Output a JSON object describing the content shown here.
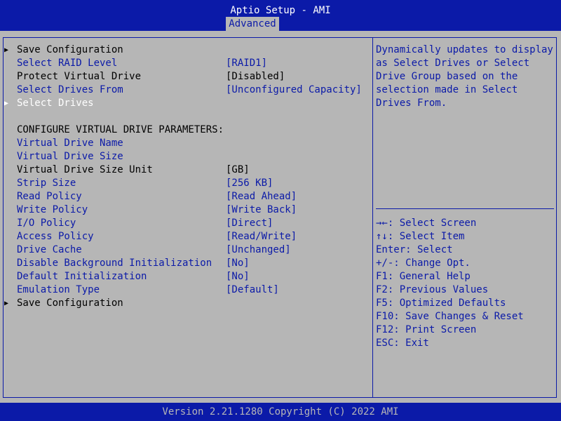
{
  "header": {
    "title": "Aptio Setup - AMI",
    "active_tab": "Advanced"
  },
  "footer": {
    "version": "Version 2.21.1280 Copyright (C) 2022 AMI"
  },
  "menu": {
    "save_config_top": "Save Configuration",
    "raid_level_label": "Select RAID Level",
    "raid_level_value": "[RAID1]",
    "protect_label": "Protect Virtual Drive",
    "protect_value": "[Disabled]",
    "drives_from_label": "Select Drives From",
    "drives_from_value": "[Unconfigured Capacity]",
    "select_drives": "Select Drives",
    "section_heading": "CONFIGURE VIRTUAL DRIVE PARAMETERS:",
    "vd_name_label": "Virtual Drive Name",
    "vd_size_label": "Virtual Drive Size",
    "vd_size_unit_label": "Virtual Drive Size Unit",
    "vd_size_unit_value": "[GB]",
    "strip_size_label": "Strip Size",
    "strip_size_value": "[256 KB]",
    "read_policy_label": "Read Policy",
    "read_policy_value": "[Read Ahead]",
    "write_policy_label": "Write Policy",
    "write_policy_value": "[Write Back]",
    "io_policy_label": "I/O Policy",
    "io_policy_value": "[Direct]",
    "access_policy_label": "Access Policy",
    "access_policy_value": "[Read/Write]",
    "drive_cache_label": "Drive Cache",
    "drive_cache_value": "[Unchanged]",
    "disable_bgi_label": "Disable Background Initialization",
    "disable_bgi_value": "[No]",
    "default_init_label": "Default Initialization",
    "default_init_value": "[No]",
    "emulation_label": "Emulation Type",
    "emulation_value": "[Default]",
    "save_config_bottom": "Save Configuration"
  },
  "help": {
    "lines": [
      "Dynamically updates to display",
      "as Select Drives or Select",
      "Drive Group based on the",
      "selection made in Select",
      "Drives From."
    ]
  },
  "keys": {
    "lines": [
      "→←: Select Screen",
      "↑↓: Select Item",
      "Enter: Select",
      "+/-: Change Opt.",
      "F1: General Help",
      "F2: Previous Values",
      "F5: Optimized Defaults",
      "F10: Save Changes & Reset",
      "F12: Print Screen",
      "ESC: Exit"
    ]
  },
  "colors": {
    "bar_blue": "#0b1aa8",
    "panel_gray": "#b6b6b6",
    "text_black": "#000000",
    "selected_white": "#ffffff"
  },
  "icons": {
    "submenu": "right-triangle-icon"
  }
}
